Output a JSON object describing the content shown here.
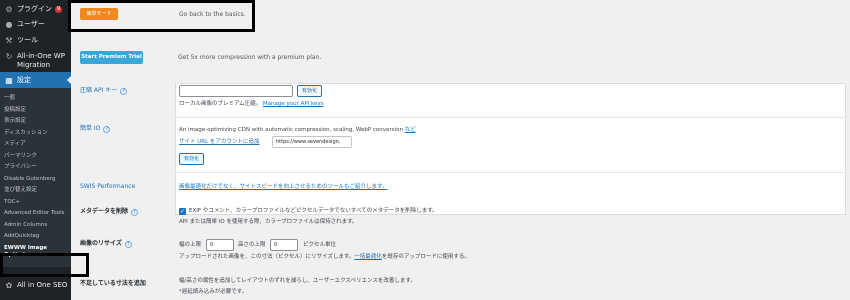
{
  "sidebar": {
    "top_items": [
      {
        "label": "プラグイン",
        "icon": "plugin-icon",
        "badge": "9"
      },
      {
        "label": "ユーザー",
        "icon": "user-icon"
      },
      {
        "label": "ツール",
        "icon": "wrench-icon"
      },
      {
        "label": "All-in-One WP Migration",
        "icon": "migration-icon"
      },
      {
        "label": "設定",
        "icon": "settings-icon",
        "active": true
      }
    ],
    "submenu": [
      "一般",
      "投稿設定",
      "表示設定",
      "ディスカッション",
      "メディア",
      "パーマリンク",
      "プライバシー",
      "Disable Gutenberg",
      "並び替え設定",
      "TOC+",
      "Advanced Editor Tools",
      "Admin Columns",
      "AddQuicktag",
      "EWWW Image Optimizer"
    ],
    "bottom_item": {
      "label": "All in One SEO",
      "icon": "seo-icon"
    }
  },
  "easy_mode": {
    "button": "簡単モード",
    "text": "Go back to the basics."
  },
  "premium": {
    "button": "Start Premium Trial",
    "text": "Get 5x more compression with a premium plan."
  },
  "api_key": {
    "label": "圧縮 API キー",
    "input_value": "",
    "activate_button": "有効化",
    "description": "ローカル画像のプレミアム圧縮。",
    "link": "Manage your API keys"
  },
  "easy_io": {
    "label": "簡単 IO",
    "description": "An image-optimizing CDN with automatic compression, scaling, WebP conversion",
    "more_link": "など",
    "site_link": "サイト URL をアカウントに追加",
    "site_url": "https://www.sevendesign.",
    "activate_button": "有効化"
  },
  "swis": {
    "label": "SWIS Performance",
    "link": "画像最適化だけでなく、サイトスピードを向上させるためのツールもご紹介します。"
  },
  "metadata": {
    "label": "メタデータを削除",
    "checkbox_label": "EXIF やコメント、カラープロファイルなどピクセルデータでないすべてのメタデータを削除します。",
    "note": "API または簡単 IO を使用する際、カラープロファイルは保持されます。"
  },
  "resize": {
    "label": "画像のリサイズ",
    "width_label": "幅の上限",
    "width_value": "0",
    "height_label": "高さの上限",
    "height_value": "0",
    "unit": "ピクセル単位",
    "note_prefix": "アップロードされた画像を、この寸法（ピクセル）にリサイズします。",
    "note_link": "一括最適化",
    "note_suffix": "を既存のアップロードに使用する。"
  },
  "missing_dims": {
    "label": "不足している寸法を追加",
    "description": "幅/高さの属性を追加してレイアウトのずれを減らし、ユーザーエクスペリエンスを改善します。",
    "note": "*遅延読み込みが必要です。"
  },
  "colors": {
    "sidebar_bg": "#1d2327",
    "active": "#2271b1",
    "orange": "#f0881e",
    "premium": "#39a8d8"
  }
}
